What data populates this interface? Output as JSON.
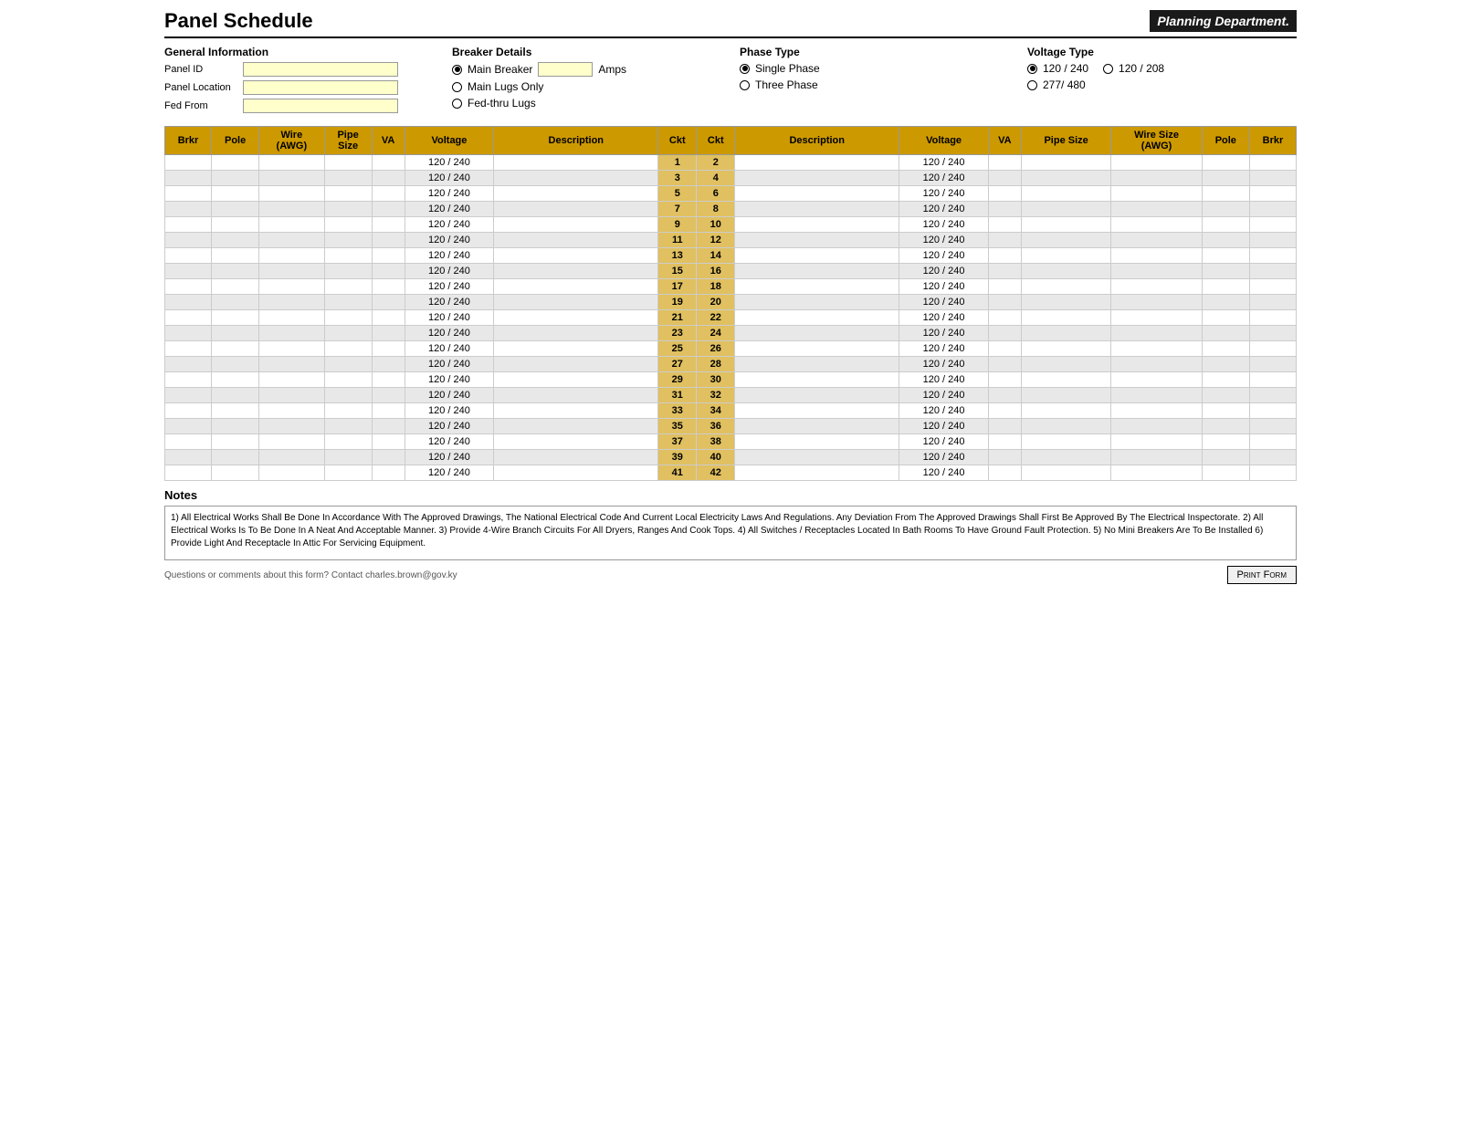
{
  "header": {
    "title": "Panel Schedule",
    "planning_dept": "Planning Department."
  },
  "general_info": {
    "title": "General Information",
    "fields": [
      {
        "label": "Panel ID",
        "value": ""
      },
      {
        "label": "Panel Location",
        "value": ""
      },
      {
        "label": "Fed From",
        "value": ""
      }
    ]
  },
  "breaker_details": {
    "title": "Breaker Details",
    "options": [
      {
        "label": "Main Breaker",
        "selected": true
      },
      {
        "label": "Main Lugs Only",
        "selected": false
      },
      {
        "label": "Fed-thru Lugs",
        "selected": false
      }
    ],
    "amps_label": "Amps"
  },
  "phase_type": {
    "title": "Phase Type",
    "options": [
      {
        "label": "Single Phase",
        "selected": true
      },
      {
        "label": "Three Phase",
        "selected": false
      }
    ]
  },
  "voltage_type": {
    "title": "Voltage Type",
    "options": [
      {
        "label": "120 / 240",
        "selected": true
      },
      {
        "label": "120 / 208",
        "selected": false
      },
      {
        "label": "277/ 480",
        "selected": false
      }
    ]
  },
  "table": {
    "headers_left": [
      "Brkr",
      "Pole",
      "Wire\n(AWG)",
      "Pipe\nSize",
      "VA",
      "Voltage",
      "Description",
      "Ckt"
    ],
    "headers_right": [
      "Ckt",
      "Description",
      "Voltage",
      "VA",
      "Pipe Size",
      "Wire Size\n(AWG)",
      "Pole",
      "Brkr"
    ],
    "rows": [
      {
        "left_ckt": 1,
        "right_ckt": 2,
        "voltage": "120 / 240"
      },
      {
        "left_ckt": 3,
        "right_ckt": 4,
        "voltage": "120 / 240"
      },
      {
        "left_ckt": 5,
        "right_ckt": 6,
        "voltage": "120 / 240"
      },
      {
        "left_ckt": 7,
        "right_ckt": 8,
        "voltage": "120 / 240"
      },
      {
        "left_ckt": 9,
        "right_ckt": 10,
        "voltage": "120 / 240"
      },
      {
        "left_ckt": 11,
        "right_ckt": 12,
        "voltage": "120 / 240"
      },
      {
        "left_ckt": 13,
        "right_ckt": 14,
        "voltage": "120 / 240"
      },
      {
        "left_ckt": 15,
        "right_ckt": 16,
        "voltage": "120 / 240"
      },
      {
        "left_ckt": 17,
        "right_ckt": 18,
        "voltage": "120 / 240"
      },
      {
        "left_ckt": 19,
        "right_ckt": 20,
        "voltage": "120 / 240"
      },
      {
        "left_ckt": 21,
        "right_ckt": 22,
        "voltage": "120 / 240"
      },
      {
        "left_ckt": 23,
        "right_ckt": 24,
        "voltage": "120 / 240"
      },
      {
        "left_ckt": 25,
        "right_ckt": 26,
        "voltage": "120 / 240"
      },
      {
        "left_ckt": 27,
        "right_ckt": 28,
        "voltage": "120 / 240"
      },
      {
        "left_ckt": 29,
        "right_ckt": 30,
        "voltage": "120 / 240"
      },
      {
        "left_ckt": 31,
        "right_ckt": 32,
        "voltage": "120 / 240"
      },
      {
        "left_ckt": 33,
        "right_ckt": 34,
        "voltage": "120 / 240"
      },
      {
        "left_ckt": 35,
        "right_ckt": 36,
        "voltage": "120 / 240"
      },
      {
        "left_ckt": 37,
        "right_ckt": 38,
        "voltage": "120 / 240"
      },
      {
        "left_ckt": 39,
        "right_ckt": 40,
        "voltage": "120 / 240"
      },
      {
        "left_ckt": 41,
        "right_ckt": 42,
        "voltage": "120 / 240"
      }
    ]
  },
  "notes": {
    "title": "Notes",
    "text": "1) All Electrical Works Shall Be Done In Accordance With The Approved Drawings, The National Electrical Code And Current Local Electricity Laws And Regulations. Any Deviation From The Approved Drawings Shall First Be Approved By The Electrical Inspectorate.  2) All Electrical Works Is To Be Done In A Neat And Acceptable Manner.  3) Provide 4-Wire Branch Circuits For All Dryers, Ranges And Cook Tops.  4) All Switches / Receptacles Located In Bath Rooms To Have Ground Fault Protection.   5) No Mini Breakers Are To Be Installed  6) Provide Light And Receptacle In Attic For Servicing Equipment."
  },
  "footer": {
    "contact": "Questions or comments about this form? Contact charles.brown@gov.ky",
    "print_button": "Print Form"
  }
}
